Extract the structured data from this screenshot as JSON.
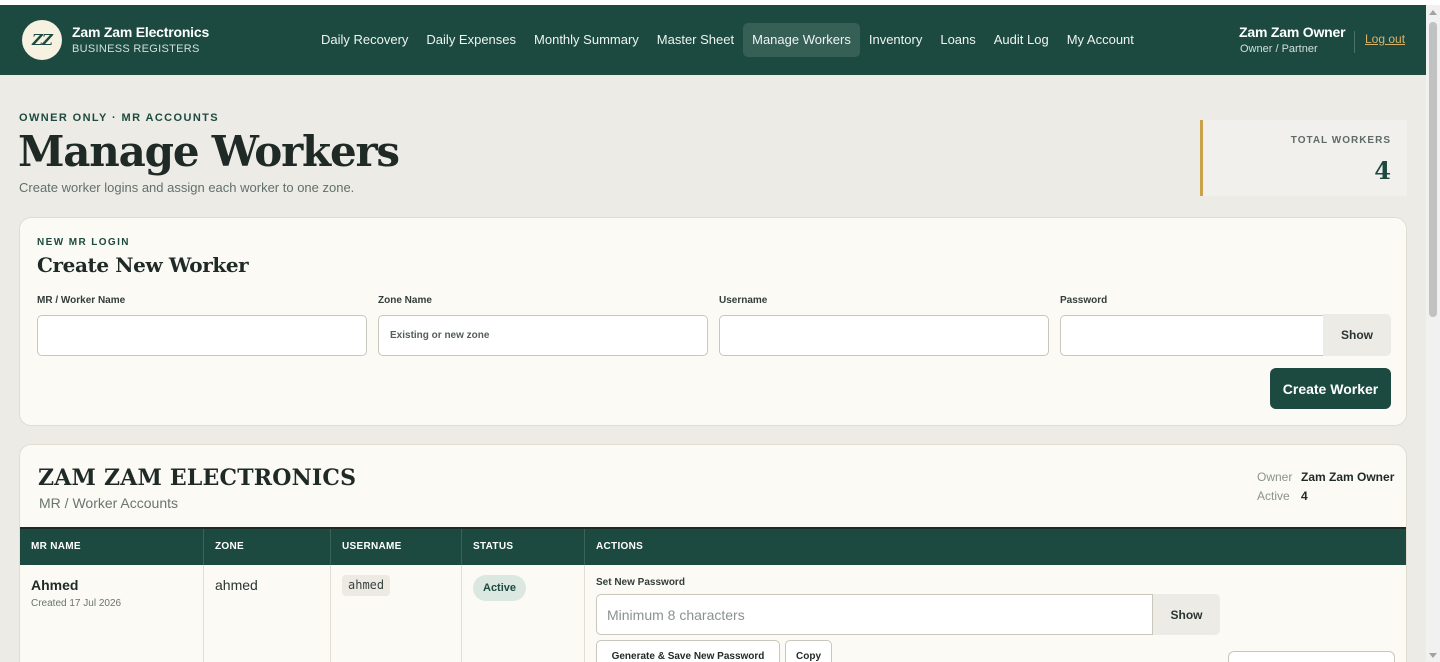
{
  "header": {
    "logo_text": "ZZ",
    "brand_name": "Zam Zam Electronics",
    "brand_sub": "BUSINESS REGISTERS",
    "nav": [
      {
        "label": "Daily Recovery"
      },
      {
        "label": "Daily Expenses"
      },
      {
        "label": "Monthly Summary"
      },
      {
        "label": "Master Sheet"
      },
      {
        "label": "Manage Workers"
      },
      {
        "label": "Inventory"
      },
      {
        "label": "Loans"
      },
      {
        "label": "Audit Log"
      },
      {
        "label": "My Account"
      }
    ],
    "active_nav": "Manage Workers",
    "user_name": "Zam Zam Owner",
    "user_role": "Owner / Partner",
    "logout_label": "Log out"
  },
  "page": {
    "eyebrow": "OWNER ONLY · MR ACCOUNTS",
    "title": "Manage Workers",
    "subtitle": "Create worker logins and assign each worker to one zone."
  },
  "stats": {
    "total_workers_label": "TOTAL WORKERS",
    "total_workers_value": "4"
  },
  "create_form": {
    "eyebrow": "NEW MR LOGIN",
    "title": "Create New Worker",
    "fields": {
      "name_label": "MR / Worker Name",
      "name_value": "",
      "name_placeholder": "",
      "zone_label": "Zone Name",
      "zone_value": "",
      "zone_placeholder": "Existing or new zone",
      "username_label": "Username",
      "username_value": "",
      "username_placeholder": "",
      "password_label": "Password",
      "password_value": "",
      "password_placeholder": "",
      "show_label": "Show"
    },
    "submit_label": "Create Worker"
  },
  "company": {
    "title": "ZAM ZAM ELECTRONICS",
    "subtitle": "MR / Worker Accounts",
    "owner_label": "Owner",
    "owner_value": "Zam Zam Owner",
    "active_label": "Active",
    "active_value": "4"
  },
  "table": {
    "columns": [
      "MR NAME",
      "ZONE",
      "USERNAME",
      "STATUS",
      "ACTIONS"
    ],
    "rows": [
      {
        "name": "Ahmed",
        "created": "Created 17 Jul 2026",
        "zone": "ahmed",
        "username": "ahmed",
        "status": "Active",
        "actions": {
          "set_password_label": "Set New Password",
          "password_placeholder": "Minimum 8 characters",
          "show_label": "Show",
          "generate_label": "Generate & Save New Password",
          "copy_label": "Copy"
        }
      }
    ]
  },
  "colors": {
    "brand": "#1d4a40",
    "accent": "#c9a24c",
    "background": "#ecebe6",
    "card": "#fbfaf5"
  }
}
